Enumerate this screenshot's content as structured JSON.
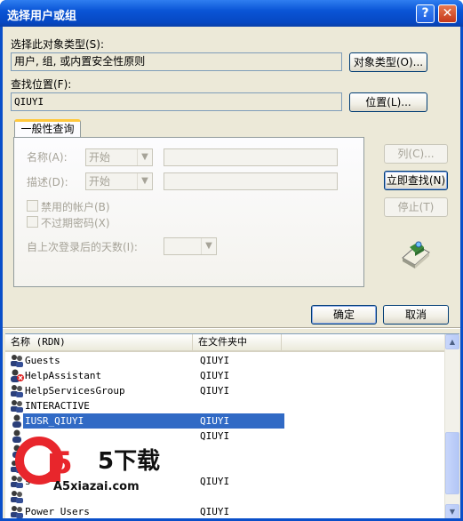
{
  "window": {
    "title": "选择用户或组",
    "help_glyph": "?",
    "close_glyph": "✕"
  },
  "object_type": {
    "label": "选择此对象类型(S):",
    "value": "用户, 组, 或内置安全性原则",
    "button": "对象类型(O)..."
  },
  "location": {
    "label": "查找位置(F):",
    "value": "QIUYI",
    "button": "位置(L)..."
  },
  "tab": {
    "label": "一般性查询"
  },
  "query": {
    "name_label": "名称(A):",
    "name_mode": "开始",
    "desc_label": "描述(D):",
    "desc_mode": "开始",
    "disabled_accounts": "禁用的帐户(B)",
    "non_expiring_pw": "不过期密码(X)",
    "days_label": "自上次登录后的天数(I):"
  },
  "side_buttons": {
    "columns": "列(C)...",
    "find_now": "立即查找(N)",
    "stop": "停止(T)"
  },
  "buttons": {
    "ok": "确定",
    "cancel": "取消"
  },
  "results": {
    "columns": [
      "名称 (RDN)",
      "在文件夹中"
    ],
    "rows": [
      {
        "name": "Guests",
        "folder": "QIUYI",
        "icon": "group-icon"
      },
      {
        "name": "HelpAssistant",
        "folder": "QIUYI",
        "icon": "disabled-user-icon"
      },
      {
        "name": "HelpServicesGroup",
        "folder": "QIUYI",
        "icon": "group-icon"
      },
      {
        "name": "INTERACTIVE",
        "folder": "",
        "icon": "group-icon"
      },
      {
        "name": "IUSR_QIUYI",
        "folder": "QIUYI",
        "icon": "user-icon",
        "selected": true
      },
      {
        "name": "",
        "folder": "QIUYI",
        "icon": "user-icon"
      },
      {
        "name": "",
        "folder": "",
        "icon": "user-icon"
      },
      {
        "name": "",
        "folder": "",
        "icon": "group-icon"
      },
      {
        "name": "s",
        "folder": "QIUYI",
        "icon": "group-icon"
      },
      {
        "name": "",
        "folder": "",
        "icon": "group-icon"
      },
      {
        "name": "Power Users",
        "folder": "QIUYI",
        "icon": "group-icon"
      }
    ]
  },
  "watermark": {
    "brand": "5下载",
    "site": "A5xiazai.com"
  },
  "colors": {
    "selection": "#316ac5",
    "titlebar": "#0a55d6",
    "dialog_bg": "#ece9d8"
  }
}
